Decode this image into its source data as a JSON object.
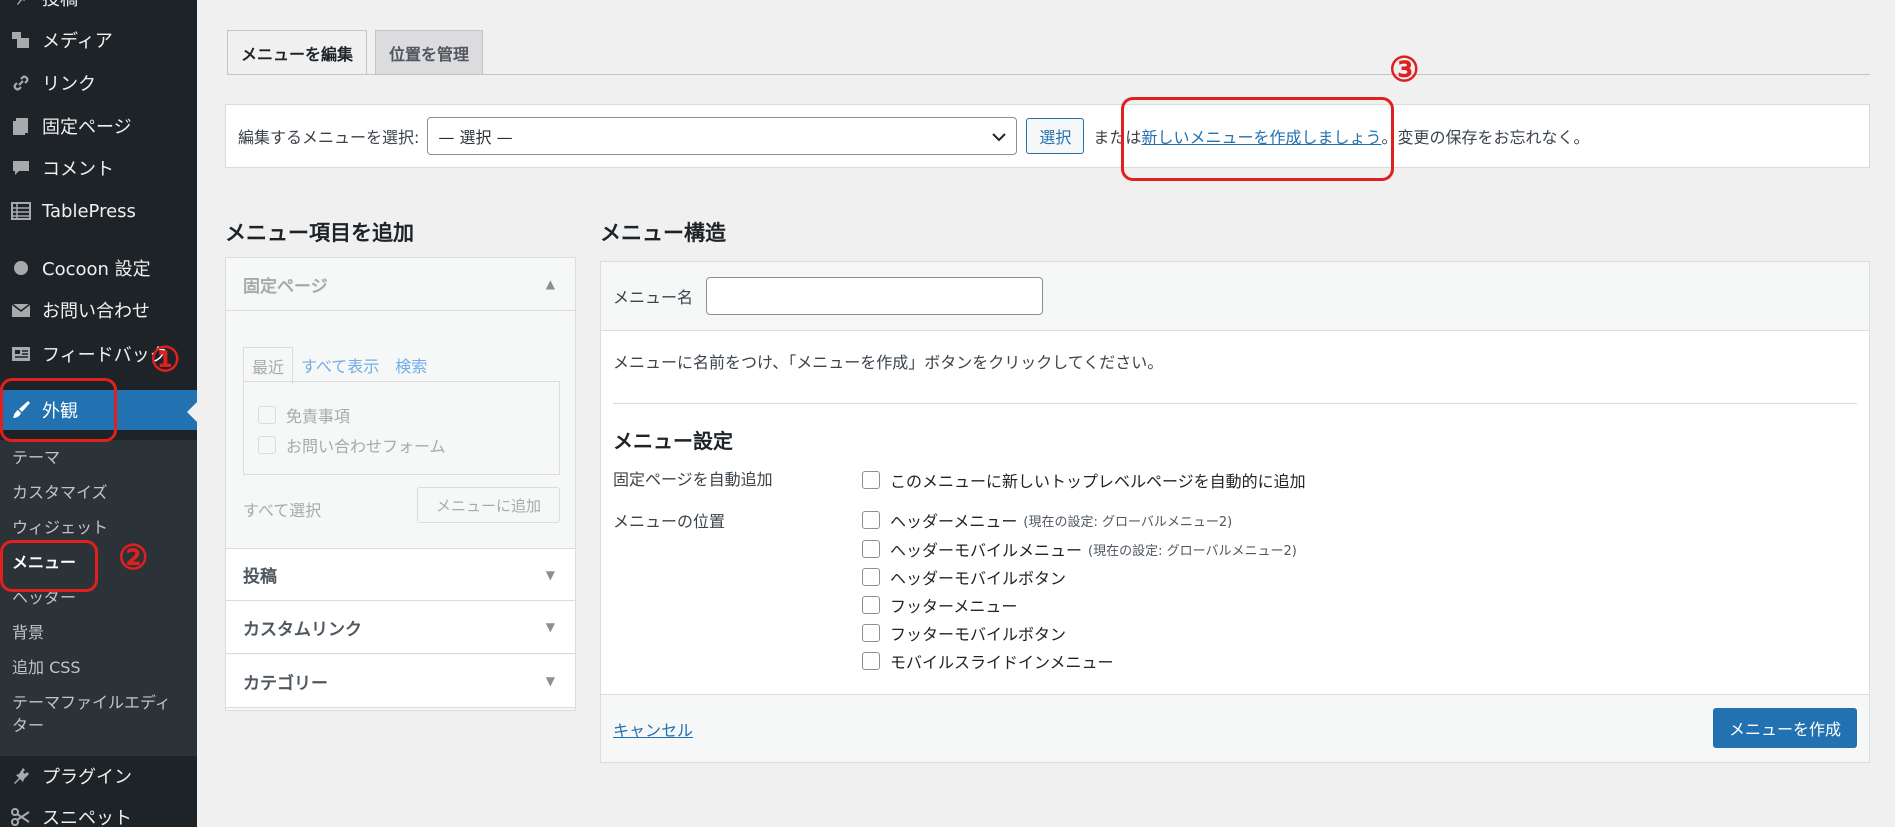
{
  "sidebar": {
    "items": [
      {
        "label": "投稿",
        "icon": "pushpin-icon"
      },
      {
        "label": "メディア",
        "icon": "media-icon"
      },
      {
        "label": "リンク",
        "icon": "link-icon"
      },
      {
        "label": "固定ページ",
        "icon": "pages-icon"
      },
      {
        "label": "コメント",
        "icon": "comment-icon"
      },
      {
        "label": "TablePress",
        "icon": "table-icon"
      },
      {
        "label": "Cocoon 設定",
        "icon": "circle-icon"
      },
      {
        "label": "お問い合わせ",
        "icon": "mail-icon"
      },
      {
        "label": "フィードバック",
        "icon": "feedback-icon"
      },
      {
        "label": "外観",
        "icon": "brush-icon"
      },
      {
        "label": "プラグイン",
        "icon": "plugin-icon"
      },
      {
        "label": "スニペット",
        "icon": "scissors-icon"
      }
    ],
    "submenu": [
      {
        "label": "テーマ"
      },
      {
        "label": "カスタマイズ"
      },
      {
        "label": "ウィジェット"
      },
      {
        "label": "メニュー"
      },
      {
        "label": "ヘッダー"
      },
      {
        "label": "背景"
      },
      {
        "label": "追加 CSS"
      },
      {
        "label": "テーマファイルエディ"
      },
      {
        "label": "ター"
      }
    ]
  },
  "tabs": {
    "edit": "メニューを編集",
    "locations": "位置を管理"
  },
  "select_bar": {
    "label": "編集するメニューを選択:",
    "selected": "— 選択 —",
    "button": "選択",
    "or_text": "または",
    "create_link": "新しいメニューを作成しましょう",
    "after_text": "。変更の保存をお忘れなく。"
  },
  "add_items": {
    "title": "メニュー項目を追加",
    "pages_header": "固定ページ",
    "inner_tabs": [
      "最近",
      "すべて表示",
      "検索"
    ],
    "pages": [
      "免責事項",
      "お問い合わせフォーム"
    ],
    "select_all": "すべて選択",
    "add_button": "メニューに追加",
    "sections": [
      "投稿",
      "カスタムリンク",
      "カテゴリー"
    ]
  },
  "structure": {
    "title": "メニュー構造",
    "name_label": "メニュー名",
    "instruction": "メニューに名前をつけ、「メニューを作成」ボタンをクリックしてください。",
    "settings_title": "メニュー設定",
    "auto_add_label": "固定ページを自動追加",
    "auto_add_option": "このメニューに新しいトップレベルページを自動的に追加",
    "location_label": "メニューの位置",
    "locations": [
      {
        "name": "ヘッダーメニュー",
        "note": "(現在の設定: グローバルメニュー2)"
      },
      {
        "name": "ヘッダーモバイルメニュー",
        "note": "(現在の設定: グローバルメニュー2)"
      },
      {
        "name": "ヘッダーモバイルボタン",
        "note": ""
      },
      {
        "name": "フッターメニュー",
        "note": ""
      },
      {
        "name": "フッターモバイルボタン",
        "note": ""
      },
      {
        "name": "モバイルスライドインメニュー",
        "note": ""
      }
    ],
    "cancel": "キャンセル",
    "create_button": "メニューを作成"
  },
  "annotations": {
    "n1": "①",
    "n2": "②",
    "n3": "③"
  },
  "colors": {
    "sidebar_bg": "#1d2327",
    "accent": "#2271b1",
    "annotation": "#e0201e"
  }
}
